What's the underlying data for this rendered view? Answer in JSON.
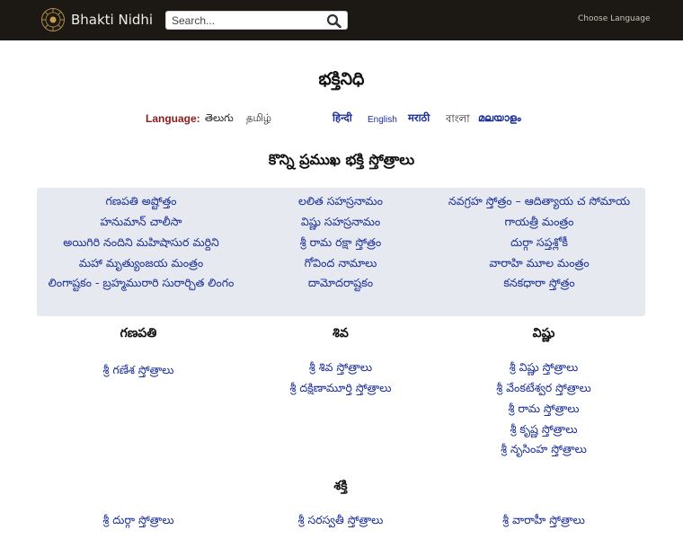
{
  "header": {
    "brand": "Bhakti Nidhi",
    "search_placeholder": "Search...",
    "choose_language": "Choose Language"
  },
  "site_title": "భక్తినిధి",
  "language_bar": {
    "label": "Language:",
    "options": [
      "తెలుగు",
      "தமிழ்",
      "हिन्दी",
      "English",
      "मराठी",
      "বাংলা",
      "മലയാളം"
    ]
  },
  "featured": {
    "title": "కొన్ని ప్రముఖ భక్తి స్తోత్రాలు",
    "col1": [
      "గణపతి అష్టోత్తం",
      "హనుమాన్ చాలీసా",
      "అయిగిరి నందిని మహిషాసుర మర్దిని",
      "మహా మృత్యుంజయ మంత్రం",
      "లింగాష్టకం - బ్రహ్మమురారి సురార్చిత లింగం"
    ],
    "col2": [
      "లలిత సహస్రనామం",
      "విష్ణు సహస్రనామం",
      "శ్రీ రామ రక్షా స్తోత్రం",
      "గోవింద నామాలు",
      "దామోదరాష్టకం"
    ],
    "col3": [
      "నవగ్రహ స్తోత్రం – ఆదిత్యాయ చ సోమాయ",
      "గాయత్రీ మంత్రం",
      "దుర్గా సప్తశ్లోకీ",
      "వారాహి మూల మంత్రం",
      "కనకధారా స్తోత్రం"
    ]
  },
  "categories": {
    "ganapati": {
      "title": "గణపతి",
      "links": [
        "శ్రీ గణేశ స్తోత్రాలు"
      ]
    },
    "shiva": {
      "title": "శివ",
      "links": [
        "శ్రీ శివ స్తోత్రాలు",
        "శ్రీ దక్షిణామూర్తి స్తోత్రాలు"
      ]
    },
    "vishnu": {
      "title": "విష్ణు",
      "links": [
        "శ్రీ విష్ణు స్తోత్రాలు",
        "శ్రీ వేంకటేశ్వర స్తోత్రాలు",
        "శ్రీ రామ స్తోత్రాలు",
        "శ్రీ కృష్ణ స్తోత్రాలు",
        "శ్రీ నృసింహ స్తోత్రాలు"
      ]
    },
    "shakti": {
      "title": "శక్తి",
      "links": [
        "శ్రీ దుర్గా స్తోత్రాలు",
        "శ్రీ సరస్వతీ స్తోత్రాలు",
        "శ్రీ వారాహీ స్తోత్రాలు"
      ]
    }
  }
}
